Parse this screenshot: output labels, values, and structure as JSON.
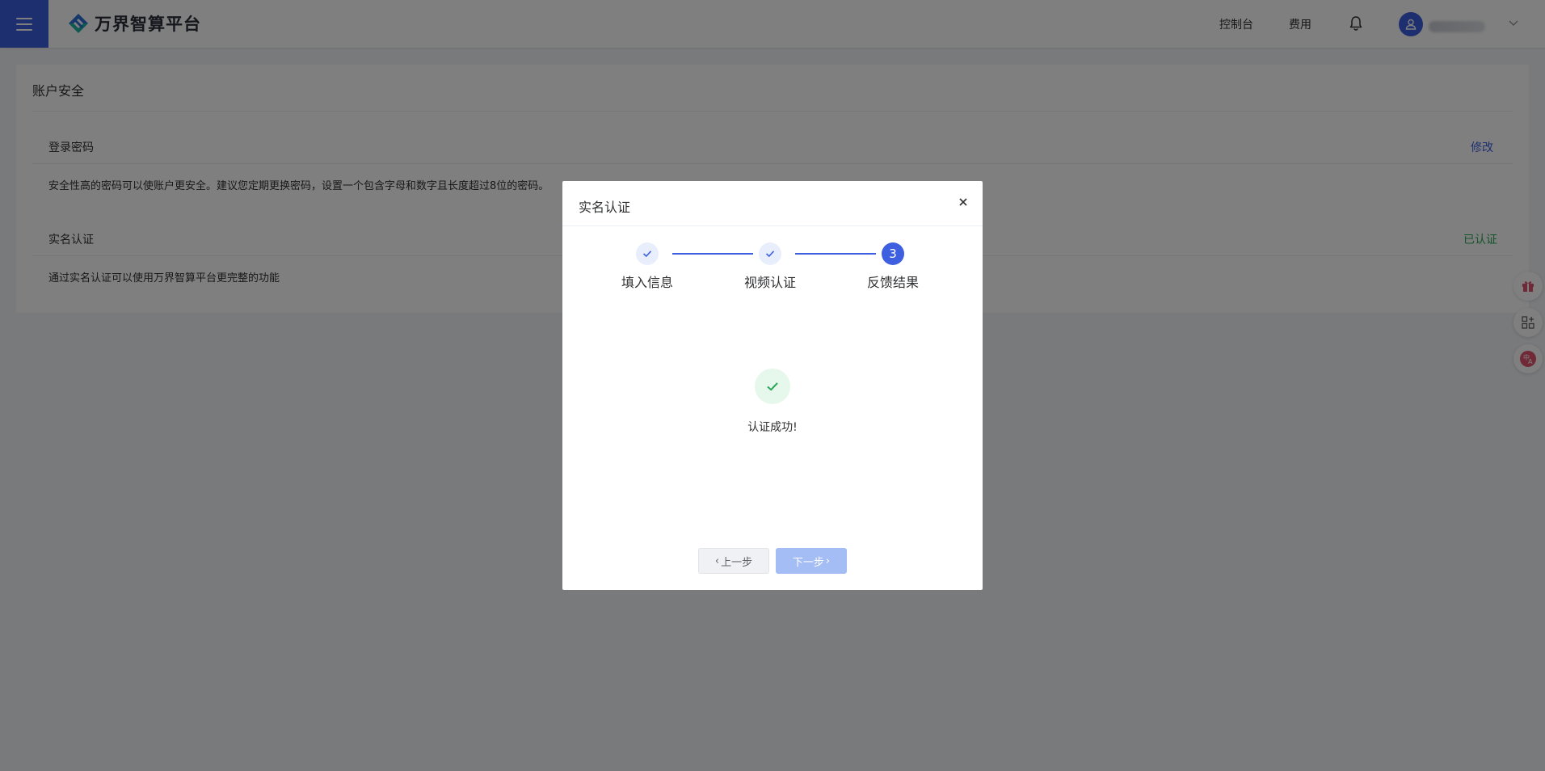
{
  "header": {
    "logo_text": "万界智算平台",
    "nav": {
      "console_label": "控制台",
      "fees_label": "费用"
    },
    "menu_icon": "hamburger-icon",
    "bell_icon": "bell-icon",
    "avatar_icon": "user-icon",
    "accent_color": "#3d5fe0"
  },
  "account_security": {
    "title": "账户安全",
    "password": {
      "label": "登录密码",
      "action": "修改",
      "description": "安全性高的密码可以使账户更安全。建议您定期更换密码，设置一个包含字母和数字且长度超过8位的密码。"
    },
    "realname": {
      "label": "实名认证",
      "status": "已认证",
      "description": "通过实名认证可以使用万界智算平台更完整的功能"
    }
  },
  "side_tools": [
    "gift-icon",
    "apps-add-icon",
    "translate-icon"
  ],
  "dialog": {
    "title": "实名认证",
    "close_label": "×",
    "steps": [
      {
        "label": "填入信息",
        "state": "done"
      },
      {
        "label": "视频认证",
        "state": "done"
      },
      {
        "label": "反馈结果",
        "state": "active",
        "number": "3"
      }
    ],
    "result_text": "认证成功!",
    "prev_label": "上一步",
    "next_label": "下一步",
    "success_color": "#2aa85a"
  }
}
